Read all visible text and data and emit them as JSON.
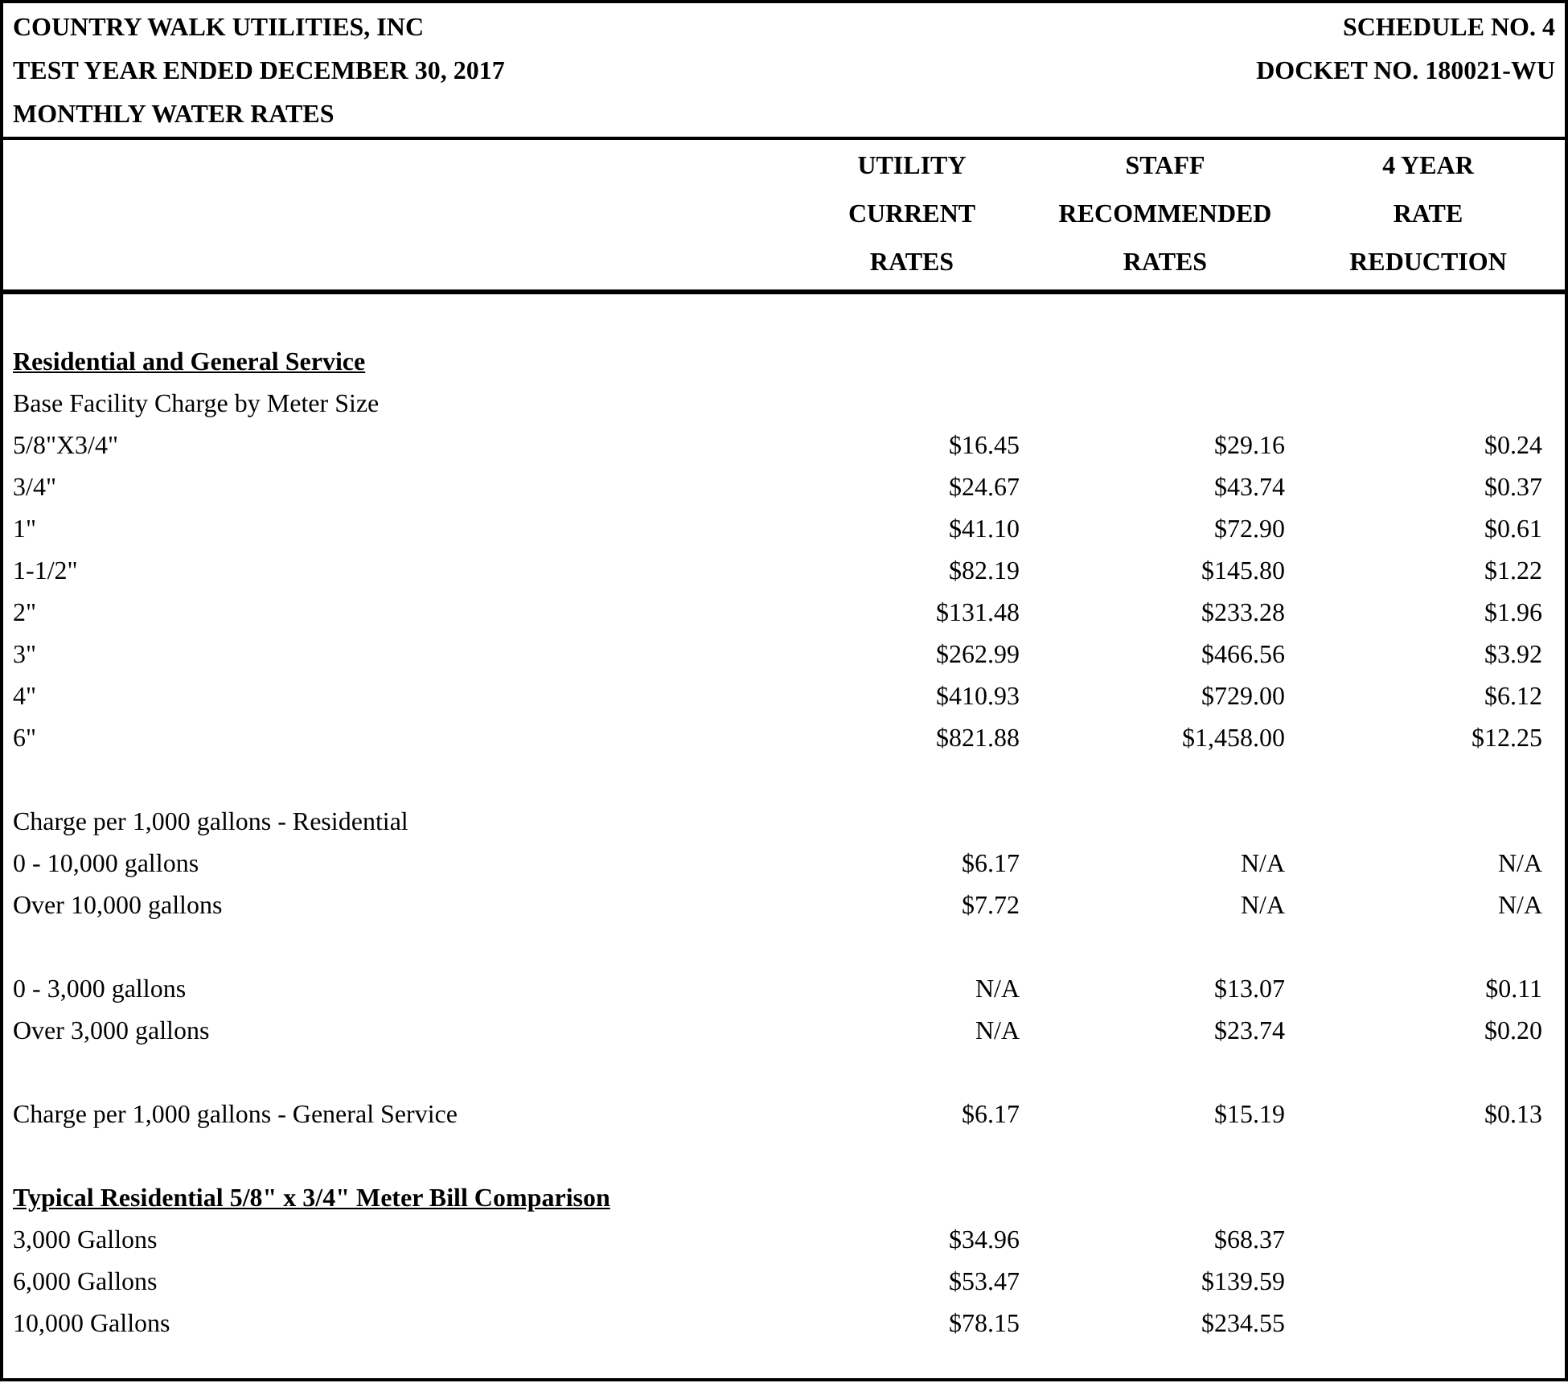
{
  "header": {
    "left": [
      "COUNTRY WALK UTILITIES, INC",
      "TEST YEAR ENDED DECEMBER 30, 2017",
      "MONTHLY WATER RATES"
    ],
    "right": [
      "SCHEDULE NO. 4",
      "DOCKET NO. 180021-WU"
    ]
  },
  "columns": [
    {
      "lines": [
        "UTILITY",
        "CURRENT",
        "RATES"
      ]
    },
    {
      "lines": [
        "STAFF",
        "RECOMMENDED",
        "RATES"
      ]
    },
    {
      "lines": [
        "4 YEAR",
        "RATE",
        "REDUCTION"
      ]
    }
  ],
  "groups": [
    {
      "title": "Residential and General Service",
      "rows": [
        {
          "label": "Base Facility Charge by Meter Size",
          "values": []
        },
        {
          "label": "5/8\"X3/4\"",
          "values": [
            "$16.45",
            "$29.16",
            "$0.24"
          ]
        },
        {
          "label": "3/4\"",
          "values": [
            "$24.67",
            "$43.74",
            "$0.37"
          ]
        },
        {
          "label": "1\"",
          "values": [
            "$41.10",
            "$72.90",
            "$0.61"
          ]
        },
        {
          "label": "1-1/2\"",
          "values": [
            "$82.19",
            "$145.80",
            "$1.22"
          ]
        },
        {
          "label": "2\"",
          "values": [
            "$131.48",
            "$233.28",
            "$1.96"
          ]
        },
        {
          "label": "3\"",
          "values": [
            "$262.99",
            "$466.56",
            "$3.92"
          ]
        },
        {
          "label": "4\"",
          "values": [
            "$410.93",
            "$729.00",
            "$6.12"
          ]
        },
        {
          "label": "6\"",
          "values": [
            "$821.88",
            "$1,458.00",
            "$12.25"
          ]
        }
      ]
    },
    {
      "rows": [
        {
          "label": "Charge per 1,000 gallons - Residential",
          "values": []
        },
        {
          "label": "0 - 10,000 gallons",
          "values": [
            "$6.17",
            "N/A",
            "N/A"
          ]
        },
        {
          "label": "Over 10,000 gallons",
          "values": [
            "$7.72",
            "N/A",
            "N/A"
          ]
        }
      ]
    },
    {
      "rows": [
        {
          "label": "0 - 3,000 gallons",
          "values": [
            "N/A",
            "$13.07",
            "$0.11"
          ]
        },
        {
          "label": "Over 3,000 gallons",
          "values": [
            "N/A",
            "$23.74",
            "$0.20"
          ]
        }
      ]
    },
    {
      "rows": [
        {
          "label": "Charge per 1,000 gallons - General Service",
          "values": [
            "$6.17",
            "$15.19",
            "$0.13"
          ]
        }
      ]
    },
    {
      "title": "Typical Residential 5/8\" x 3/4\" Meter Bill Comparison",
      "rows": [
        {
          "label": "3,000 Gallons",
          "values": [
            "$34.96",
            "$68.37"
          ]
        },
        {
          "label": "6,000 Gallons",
          "values": [
            "$53.47",
            "$139.59"
          ]
        },
        {
          "label": "10,000 Gallons",
          "values": [
            "$78.15",
            "$234.55"
          ]
        }
      ]
    }
  ]
}
